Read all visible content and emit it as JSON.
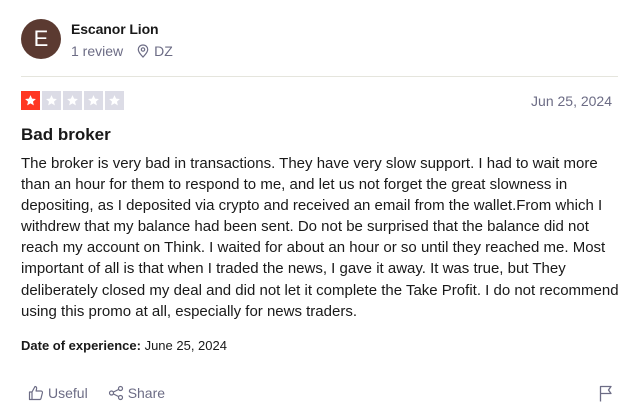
{
  "reviewer": {
    "avatar_letter": "E",
    "name": "Escanor Lion",
    "review_count": "1 review",
    "country": "DZ",
    "avatar_color": "#5b3a31"
  },
  "review": {
    "rating": 1,
    "max_rating": 5,
    "date": "Jun 25, 2024",
    "title": "Bad broker",
    "body": "The broker is very bad in transactions. They have very slow support. I had to wait more than an hour for them to respond to me, and let us not forget the great slowness in depositing, as I deposited via crypto and received an email from the wallet.From which I withdrew that my balance had been sent. Do not be surprised that the balance did not reach my account on Think. I waited for about an hour or so until they reached me. Most important of all is that when I traded the news, I gave it away. It was true, but They deliberately closed my deal and did not let it complete the Take Profit. I do not recommend using this promo at all, especially for news traders.",
    "experience_label": "Date of experience:",
    "experience_date": "June 25, 2024",
    "star_on_color": "#ff3722",
    "star_off_color": "#dcdce6"
  },
  "actions": {
    "useful_label": "Useful",
    "share_label": "Share",
    "icons": [
      "thumbs-up-icon",
      "share-icon",
      "flag-icon"
    ]
  }
}
